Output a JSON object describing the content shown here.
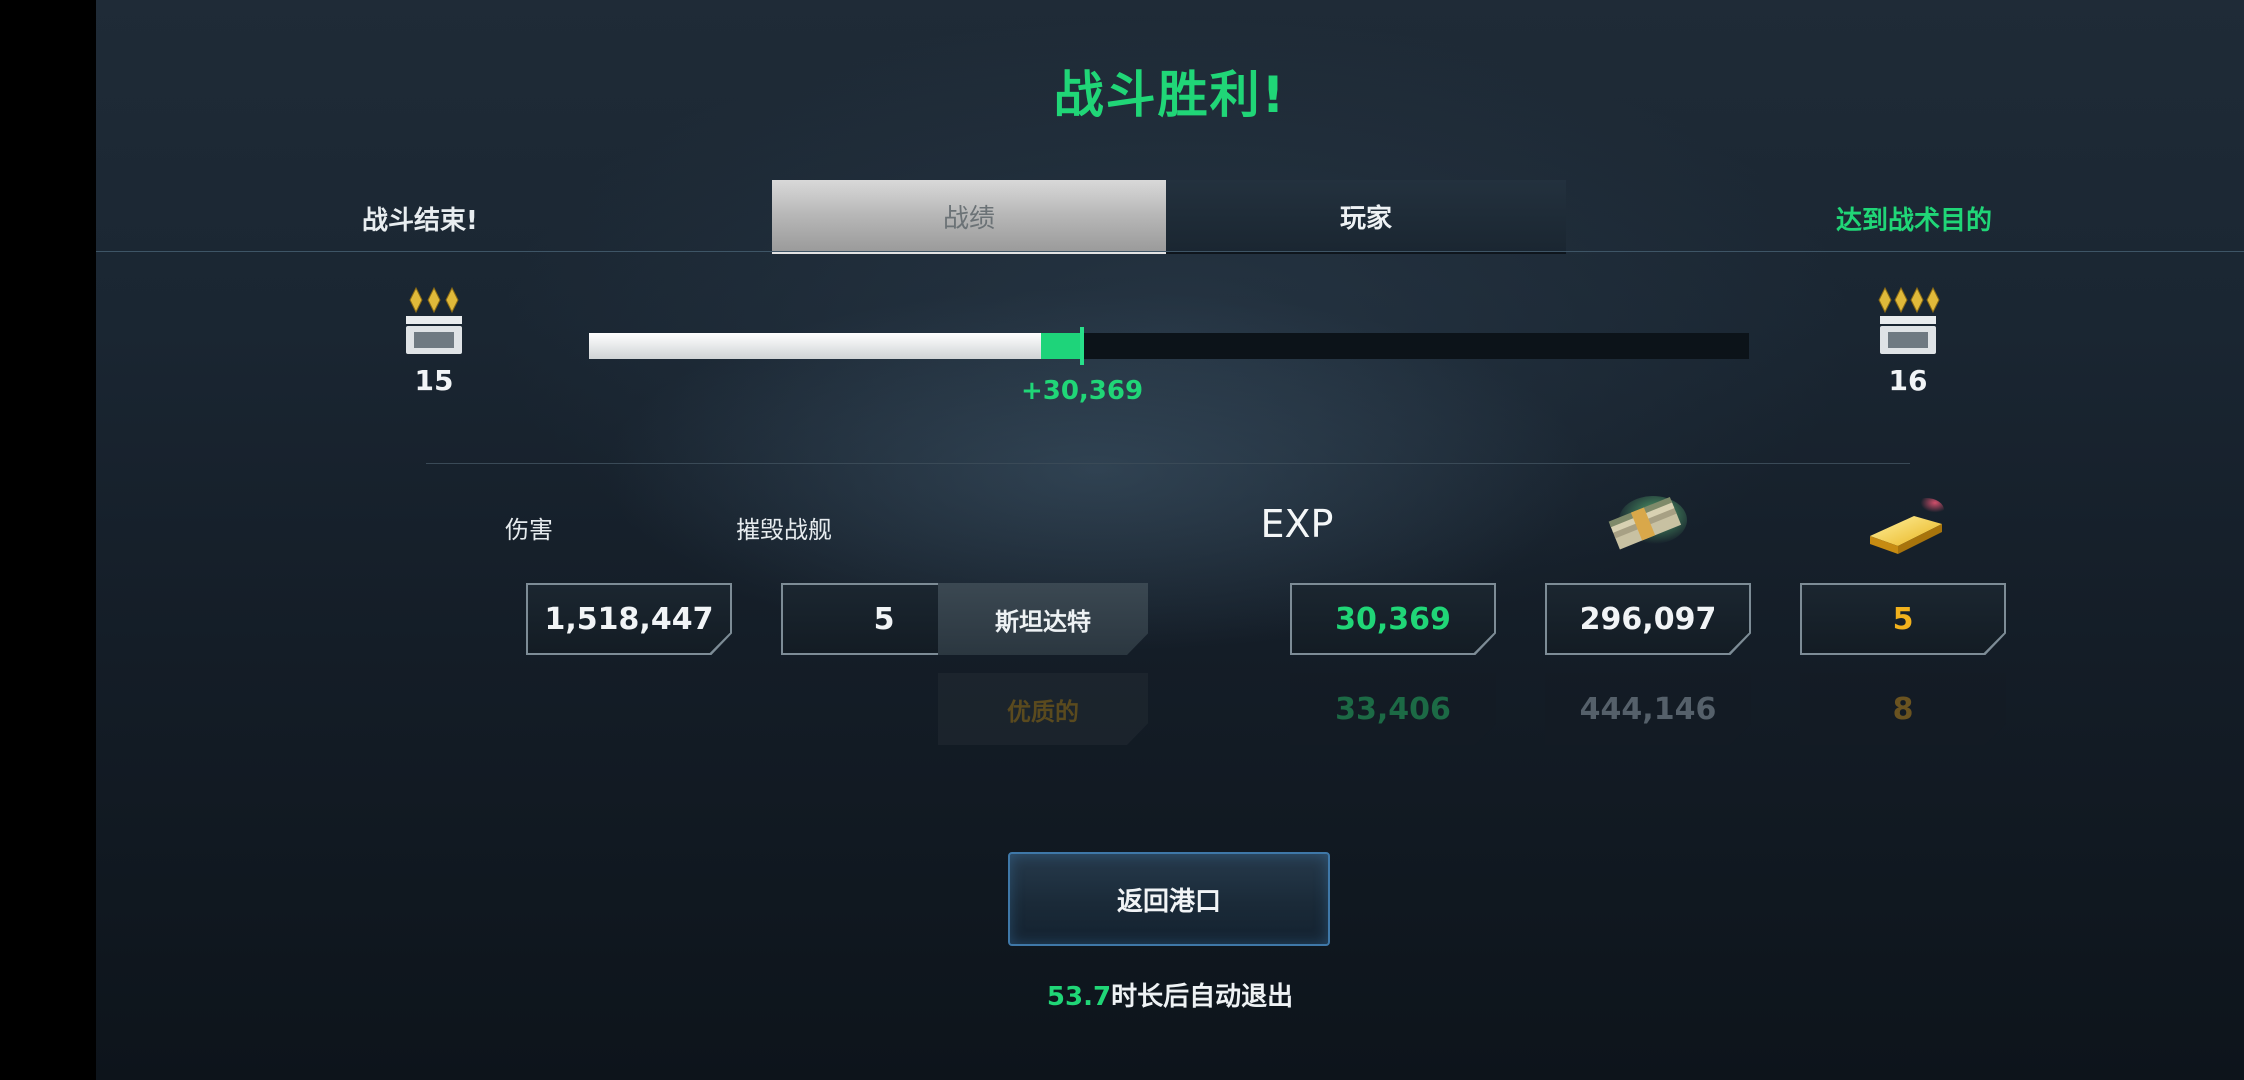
{
  "header": {
    "title": "战斗胜利!",
    "left_status": "战斗结束!",
    "right_status": "达到战术目的"
  },
  "tabs": [
    {
      "label": "战绩",
      "active": true
    },
    {
      "label": "玩家",
      "active": false
    }
  ],
  "progress": {
    "current_rank": "15",
    "next_rank": "16",
    "gain_label": "+30,369",
    "base_fraction": 0.39,
    "gained_fraction": 0.035
  },
  "columns": {
    "damage": "伤害",
    "kills": "摧毁战舰",
    "exp": "EXP",
    "money_icon": "money-stack-icon",
    "gold_icon": "gold-bar-icon"
  },
  "results": {
    "damage": "1,518,447",
    "kills": "5",
    "ship_name": "斯坦达特",
    "exp": "30,369",
    "money": "296,097",
    "gold": "5"
  },
  "premium": {
    "label": "优质的",
    "exp": "33,406",
    "money": "444,146",
    "gold": "8"
  },
  "footer": {
    "return_button": "返回港口",
    "countdown": "53.7",
    "auto_exit_text": "时长后自动退出"
  },
  "colors": {
    "accent_green": "#20d677",
    "gold": "#f2b21d"
  }
}
